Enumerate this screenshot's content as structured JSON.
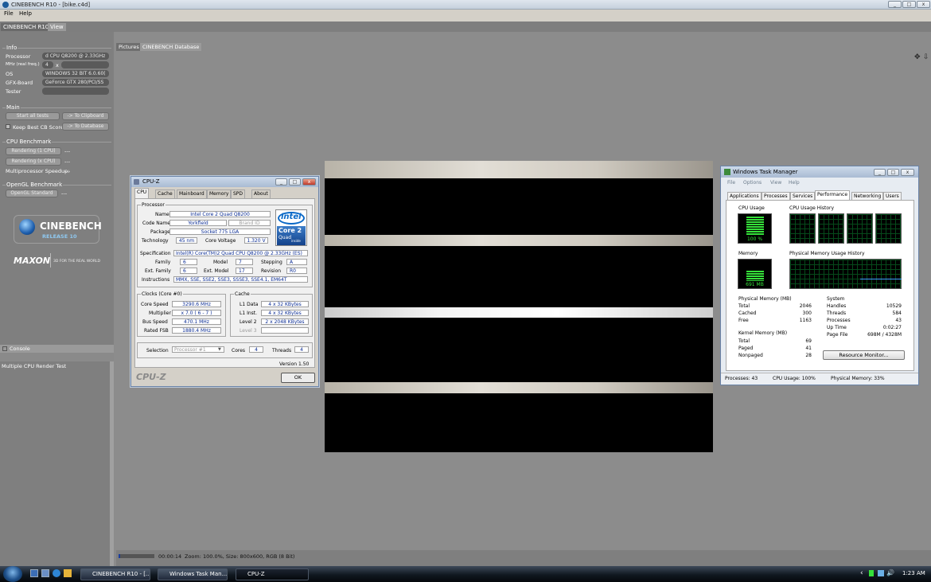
{
  "window": {
    "title": "CINEBENCH R10 - [bike.c4d]",
    "min": "_",
    "max": "□",
    "close": "x"
  },
  "menu": [
    "File",
    "Help"
  ],
  "app_tabs": [
    "CINEBENCH R10",
    "View"
  ],
  "info": {
    "header": "Info",
    "labels": [
      "Processor",
      "MHz (real freq.)",
      "OS",
      "GFX-Board",
      "Tester"
    ],
    "processor": "d CPU Q8200 @ 2.33GHz",
    "mhz": "4",
    "mhz_x": "x",
    "os": "WINDOWS 32 BIT 6.0.60(",
    "gfx": "GeForce GTX 280/PCI/SS",
    "tester": ""
  },
  "main": {
    "header": "Main",
    "start": "Start all tests",
    "clipboard": "-> To Clipboard",
    "keep": "Keep Best CB Score",
    "database": "-> To Database"
  },
  "cpu_bench": {
    "header": "CPU Benchmark",
    "single": "Rendering (1 CPU)",
    "single_val": "---",
    "multi": "Rendering (x CPU)",
    "multi_val": "---",
    "speedup": "Multiprocessor Speedup:",
    "speedup_val": "---"
  },
  "opengl": {
    "header": "OpenGL Benchmark",
    "btn": "OpenGL Standard",
    "val": "---"
  },
  "logos": {
    "cinebench": "CINEBENCH",
    "release": "RELEASE 10",
    "maxon": "MAXON",
    "tagline": "3D FOR THE REAL WORLD"
  },
  "console": {
    "header": "Console",
    "text": "Multiple CPU Render Test"
  },
  "render_tabs": [
    "Pictures",
    "CINEBENCH Database"
  ],
  "status": {
    "time": "00:00:14",
    "info": "Zoom: 100.0%, Size: 800x600, RGB (8 Bit)",
    "progress": 0.05
  },
  "cpuz": {
    "title": "CPU-Z",
    "tabs": [
      "CPU",
      "Cache",
      "Mainboard",
      "Memory",
      "SPD",
      "About"
    ],
    "processor_hdr": "Processor",
    "name_l": "Name",
    "name": "Intel Core 2 Quad Q8200",
    "codename_l": "Code Name",
    "codename": "Yorkfield",
    "brandid": "Brand ID",
    "package_l": "Package",
    "package": "Socket 775 LGA",
    "tech_l": "Technology",
    "tech": "45 nm",
    "volt_l": "Core Voltage",
    "volt": "1.320 V",
    "spec_l": "Specification",
    "spec": "Intel(R) Core(TM)2 Quad CPU    Q8200  @ 2.33GHz (ES)",
    "family_l": "Family",
    "family": "6",
    "model_l": "Model",
    "model": "7",
    "stepping_l": "Stepping",
    "stepping": "A",
    "extfam_l": "Ext. Family",
    "extfam": "6",
    "extmodel_l": "Ext. Model",
    "extmodel": "17",
    "rev_l": "Revision",
    "rev": "R0",
    "instr_l": "Instructions",
    "instr": "MMX, SSE, SSE2, SSE3, SSSE3, SSE4.1, EM64T",
    "clocks_hdr": "Clocks (Core #0)",
    "corespeed_l": "Core Speed",
    "corespeed": "3290.6 MHz",
    "mult_l": "Multiplier",
    "mult": "x 7.0 ( 6 - 7 )",
    "bus_l": "Bus Speed",
    "bus": "470.1 MHz",
    "fsb_l": "Rated FSB",
    "fsb": "1880.4 MHz",
    "cache_hdr": "Cache",
    "l1d_l": "L1 Data",
    "l1d": "4 x 32 KBytes",
    "l1i_l": "L1 Inst.",
    "l1i": "4 x 32 KBytes",
    "l2_l": "Level 2",
    "l2": "2 x 2048 KBytes",
    "l3_l": "Level 3",
    "l3": "",
    "sel_l": "Selection",
    "sel": "Processor #1",
    "cores_l": "Cores",
    "cores": "4",
    "threads_l": "Threads",
    "threads": "4",
    "version": "Version 1.50",
    "brand": "CPU-Z",
    "ok": "OK",
    "intel": "intel",
    "core2": "Core 2",
    "quad": "Quad",
    "inside": "inside"
  },
  "taskmgr": {
    "title": "Windows Task Manager",
    "menu": [
      "File",
      "Options",
      "View",
      "Help"
    ],
    "tabs": [
      "Applications",
      "Processes",
      "Services",
      "Performance",
      "Networking",
      "Users"
    ],
    "cpu_usage_l": "CPU Usage",
    "cpu_usage": "100 %",
    "cpu_usage_pct": 1.0,
    "cpu_hist_l": "CPU Usage History",
    "mem_l": "Memory",
    "mem": "691 MB",
    "pm_hist_l": "Physical Memory Usage History",
    "phys_hdr": "Physical Memory (MB)",
    "phys": [
      [
        "Total",
        "2046"
      ],
      [
        "Cached",
        "300"
      ],
      [
        "Free",
        "1163"
      ]
    ],
    "kern_hdr": "Kernel Memory (MB)",
    "kern": [
      [
        "Total",
        "69"
      ],
      [
        "Paged",
        "41"
      ],
      [
        "Nonpaged",
        "28"
      ]
    ],
    "sys_hdr": "System",
    "sys": [
      [
        "Handles",
        "10529"
      ],
      [
        "Threads",
        "584"
      ],
      [
        "Processes",
        "43"
      ],
      [
        "Up Time",
        "0:02:27"
      ],
      [
        "Page File",
        "698M / 4328M"
      ]
    ],
    "resmon": "Resource Monitor...",
    "status": [
      "Processes: 43",
      "CPU Usage: 100%",
      "Physical Memory: 33%"
    ]
  },
  "taskbar": {
    "items": [
      "CINEBENCH R10 - [...",
      "Windows Task Man...",
      "CPU-Z"
    ],
    "time": "1:23 AM",
    "chevron": "‹"
  }
}
